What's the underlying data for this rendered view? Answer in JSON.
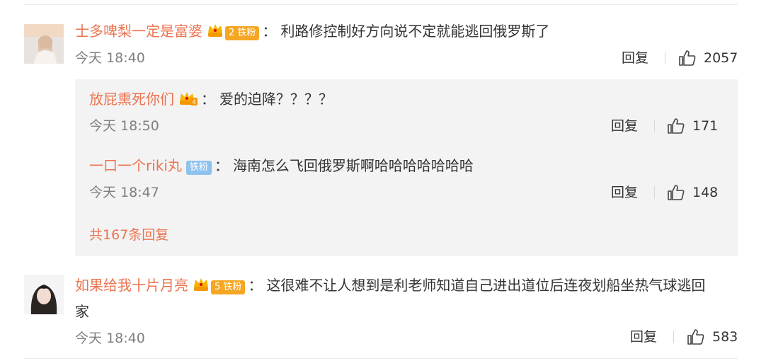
{
  "comments": [
    {
      "username": "士多啤梨一定是富婆",
      "badge_level": "2",
      "badge_fan": "铁粉",
      "text": "利路修控制好方向说不定就能逃回俄罗斯了",
      "time": "今天 18:40",
      "reply_label": "回复",
      "likes": "2057",
      "replies": [
        {
          "username": "放屁熏死你们",
          "badge_level": "4",
          "text": "爱的迫降？？？？",
          "time": "今天 18:50",
          "reply_label": "回复",
          "likes": "171"
        },
        {
          "username": "一口一个riki丸",
          "badge_fan": "铁粉",
          "text": "海南怎么飞回俄罗斯啊哈哈哈哈哈哈哈",
          "time": "今天 18:47",
          "reply_label": "回复",
          "likes": "148"
        }
      ],
      "more_replies": "共167条回复"
    },
    {
      "username": "如果给我十片月亮",
      "badge_level": "5",
      "badge_fan": "铁粉",
      "text_line1": "这很难不让人想到是利老师知道自己进出道位后连夜划船坐热气球逃回",
      "text_line2": "家",
      "time": "今天 18:40",
      "reply_label": "回复",
      "likes": "583"
    }
  ],
  "colors": {
    "username": "#eb7350",
    "meta": "#808080",
    "reply_box_bg": "#f3f3f3",
    "badge_orange": "#f5a623",
    "badge_blue": "#8fc1ee"
  },
  "icons": [
    "thumbs-up-icon",
    "crown-badge-icon"
  ]
}
